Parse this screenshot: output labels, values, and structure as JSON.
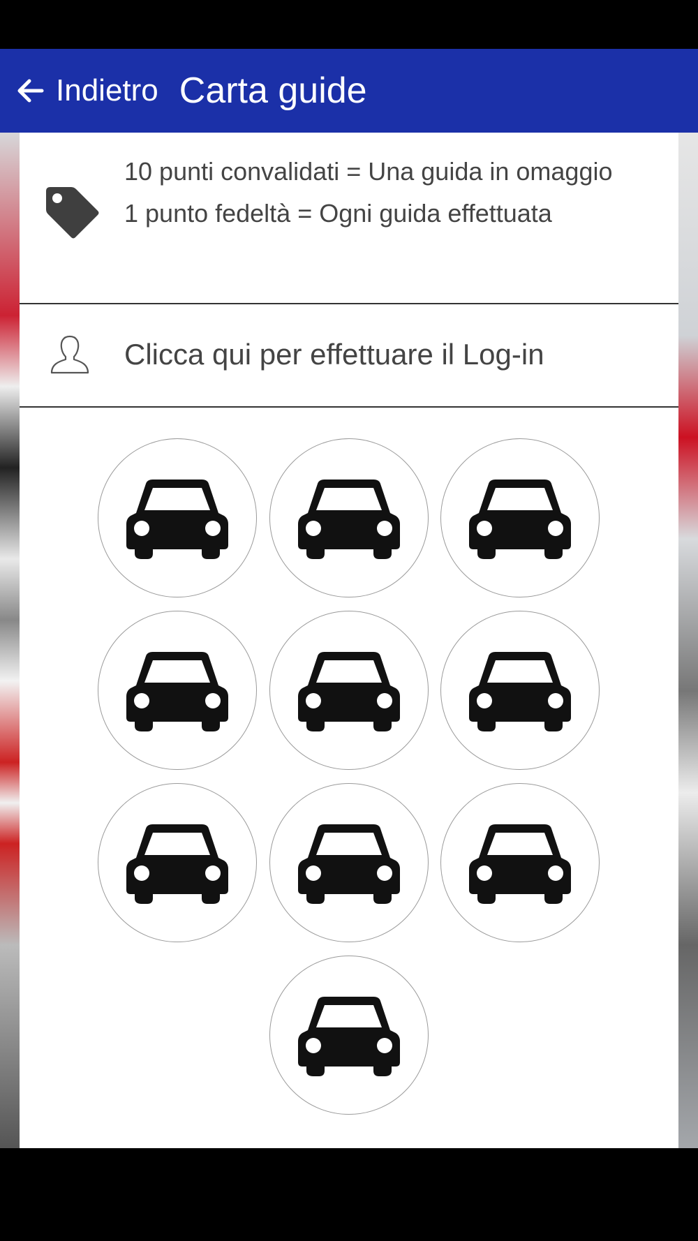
{
  "app_bar": {
    "back_label": "Indietro",
    "title": "Carta guide",
    "color": "#1b30a8"
  },
  "info": {
    "icon": "tag-icon",
    "line1": "10 punti convalidati = Una guida in omaggio",
    "line2": "1 punto fedeltà = Ogni guida effettuata"
  },
  "login": {
    "icon": "user-icon",
    "label": "Clicca qui per effettuare il Log-in"
  },
  "stamps": {
    "total": 10,
    "icon": "car-icon"
  }
}
